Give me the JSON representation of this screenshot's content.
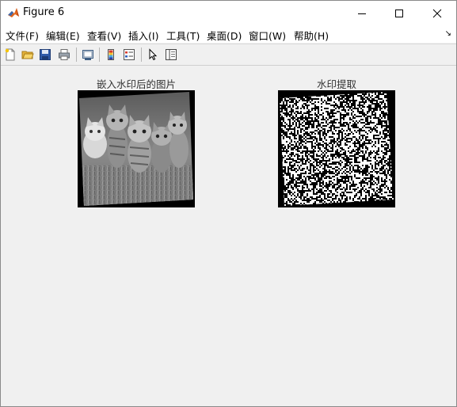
{
  "window": {
    "title": "Figure 6"
  },
  "menu": [
    "文件(F)",
    "编辑(E)",
    "查看(V)",
    "插入(I)",
    "工具(T)",
    "桌面(D)",
    "窗口(W)",
    "帮助(H)"
  ],
  "menu_overflow": "↘",
  "toolbar": [
    "new-figure",
    "open-file",
    "save",
    "print",
    "link-plot",
    "colorbar",
    "legend",
    "pointer",
    "property-inspector"
  ],
  "axes": [
    {
      "title": "嵌入水印后的图片"
    },
    {
      "title": "水印提取"
    }
  ]
}
